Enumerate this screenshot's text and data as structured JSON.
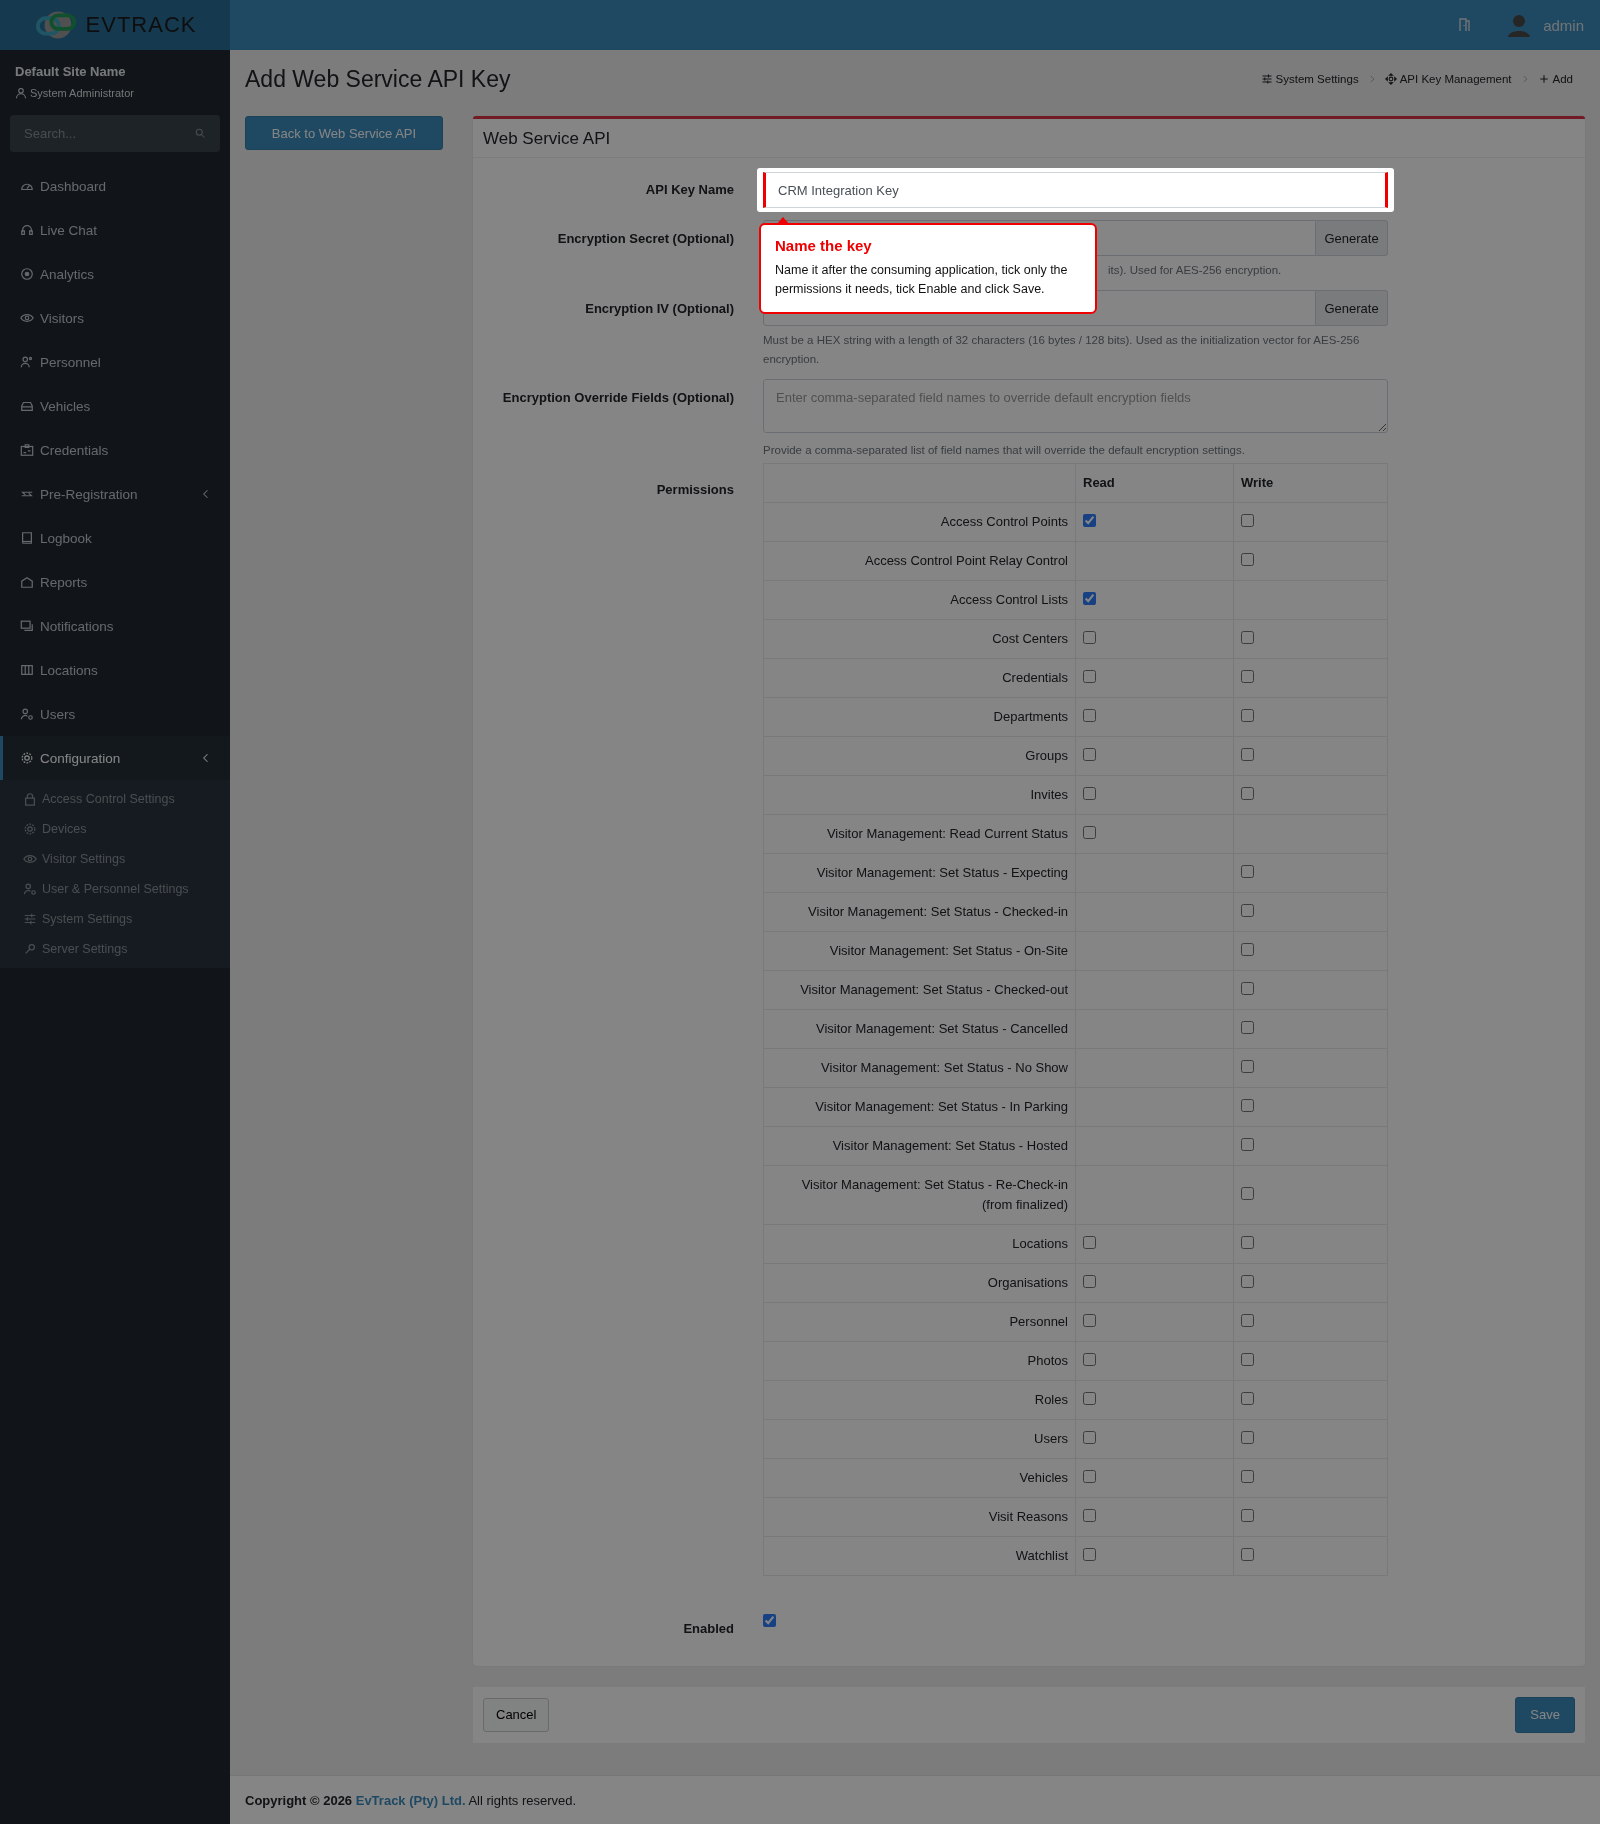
{
  "header": {
    "logo_text": "**EV**TRACK",
    "user": "admin"
  },
  "sidebar": {
    "site_name": "Default Site Name",
    "role": "System Administrator",
    "search": {
      "placeholder": "Search..."
    },
    "items": [
      {
        "label": "Dashboard",
        "selected": false
      },
      {
        "label": "Live Chat",
        "selected": false
      },
      {
        "label": "Analytics",
        "selected": false
      },
      {
        "label": "Visitors",
        "selected": false
      },
      {
        "label": "Personnel",
        "selected": false
      },
      {
        "label": "Vehicles",
        "selected": false
      },
      {
        "label": "Credentials",
        "selected": false
      },
      {
        "label": "Pre-Registration",
        "selected": false,
        "collapsible": true
      },
      {
        "label": "Logbook",
        "selected": false
      },
      {
        "label": "Reports",
        "selected": false
      },
      {
        "label": "Notifications",
        "selected": false
      },
      {
        "label": "Locations",
        "selected": false
      },
      {
        "label": "Users",
        "selected": false
      },
      {
        "label": "Configuration",
        "selected": true,
        "collapsible": true,
        "children": [
          {
            "label": "Access Control Settings"
          },
          {
            "label": "Devices"
          },
          {
            "label": "Visitor Settings"
          },
          {
            "label": "User & Personnel Settings"
          },
          {
            "label": "System Settings"
          },
          {
            "label": "Server Settings"
          }
        ]
      }
    ]
  },
  "page": {
    "title": "Add Web Service API Key",
    "breadcrumb": [
      {
        "label": "System Settings"
      },
      {
        "label": "API Key Management"
      },
      {
        "label": "Add"
      }
    ],
    "back_button": "Back to Web Service API"
  },
  "card": {
    "title": "Web Service API",
    "fields": [
      {
        "kind": "text",
        "label": "API Key Name",
        "value": "CRM Integration Key",
        "highlighted": true
      },
      {
        "kind": "generate",
        "label": "Encryption Secret (Optional)",
        "button": "Generate",
        "hint": "its). Used for AES-256 encryption.",
        "hint_covered": true
      },
      {
        "kind": "generate",
        "label": "Encryption IV (Optional)",
        "button": "Generate",
        "hint": "Must be a HEX string with a length of 32 characters (16 bytes / 128 bits). Used as the initialization vector for AES-256 encryption."
      },
      {
        "kind": "textarea",
        "label": "Encryption Override Fields (Optional)",
        "placeholder": "Enter comma-separated field names to override default encryption fields",
        "hint": "Provide a comma-separated list of field names that will override the default encryption settings."
      }
    ],
    "permissions": {
      "label": "Permissions",
      "columns": [
        "Read",
        "Write"
      ],
      "rows": [
        {
          "name": "Access Control Points",
          "read": true,
          "write": false
        },
        {
          "name": "Access Control Point Relay Control",
          "write": false
        },
        {
          "name": "Access Control Lists",
          "read": true
        },
        {
          "name": "Cost Centers",
          "read": false,
          "write": false
        },
        {
          "name": "Credentials",
          "read": false,
          "write": false
        },
        {
          "name": "Departments",
          "read": false,
          "write": false
        },
        {
          "name": "Groups",
          "read": false,
          "write": false
        },
        {
          "name": "Invites",
          "read": false,
          "write": false
        },
        {
          "name": "Visitor Management: Read Current Status",
          "read": false
        },
        {
          "name": "Visitor Management: Set Status - Expecting",
          "write": false
        },
        {
          "name": "Visitor Management: Set Status - Checked-in",
          "write": false
        },
        {
          "name": "Visitor Management: Set Status - On-Site",
          "write": false
        },
        {
          "name": "Visitor Management: Set Status - Checked-out",
          "write": false
        },
        {
          "name": "Visitor Management: Set Status - Cancelled",
          "write": false
        },
        {
          "name": "Visitor Management: Set Status - No Show",
          "write": false
        },
        {
          "name": "Visitor Management: Set Status - In Parking",
          "write": false
        },
        {
          "name": "Visitor Management: Set Status - Hosted",
          "write": false
        },
        {
          "name": "Visitor Management: Set Status - Re-Check-in (from finalized)",
          "write": false
        },
        {
          "name": "Locations",
          "read": false,
          "write": false
        },
        {
          "name": "Organisations",
          "read": false,
          "write": false
        },
        {
          "name": "Personnel",
          "read": false,
          "write": false
        },
        {
          "name": "Photos",
          "read": false,
          "write": false
        },
        {
          "name": "Roles",
          "read": false,
          "write": false
        },
        {
          "name": "Users",
          "read": false,
          "write": false
        },
        {
          "name": "Vehicles",
          "read": false,
          "write": false
        },
        {
          "name": "Visit Reasons",
          "read": false,
          "write": false
        },
        {
          "name": "Watchlist",
          "read": false,
          "write": false
        }
      ]
    },
    "enabled": {
      "label": "Enabled",
      "checked": true
    }
  },
  "actions": {
    "cancel": "Cancel",
    "save": "Save"
  },
  "footer": {
    "prefix": "Copyright © 2026",
    "link": "EvTrack (Pty) Ltd.",
    "suffix": "All rights reserved."
  },
  "tour_tip": {
    "title": "Name the key",
    "text": "Name it after the consuming application, tick only the permissions it needs, tick Enable and click Save."
  }
}
